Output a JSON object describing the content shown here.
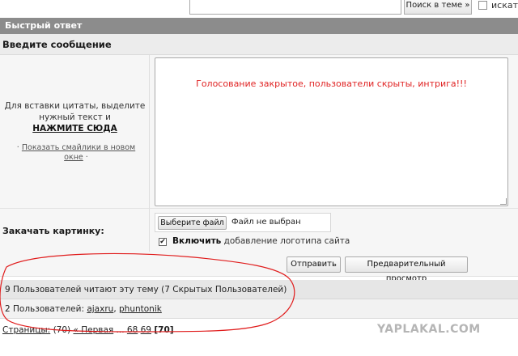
{
  "top": {
    "search_topic_button": "Поиск в теме »",
    "search_checkbox_label": "искат"
  },
  "reply": {
    "header": "Быстрый ответ",
    "subheader": "Введите сообщение",
    "quote_hint": "Для вставки цитаты, выделите нужный текст и",
    "quote_link": "НАЖМИТЕ СЮДА",
    "smileys_prefix": "·",
    "smileys_link": "Показать смайлики в новом окне",
    "smileys_suffix": "·",
    "message_text": "Голосование закрытое, пользователи скрыты, интрига!!!"
  },
  "upload": {
    "label": "Закачать картинку:",
    "choose_button": "Выберите файл",
    "file_status": "Файл не выбран",
    "logo_checked": true,
    "logo_bold": "Включить",
    "logo_rest": " добавление логотипа сайта"
  },
  "actions": {
    "send": "Отправить",
    "preview": "Предварительный просмотр"
  },
  "readers": {
    "summary": "9 Пользователей читают эту тему (7 Скрытых Пользователей)",
    "users_prefix": "2 Пользователей: ",
    "users": [
      "ajaxru",
      "phuntonik"
    ]
  },
  "pagination": {
    "label": "Страницы:",
    "total": "(70)",
    "first": "« Первая",
    "dots": "...",
    "pages": [
      "68",
      "69"
    ],
    "current": "[70]"
  },
  "watermark": "YAPLAKAL.COM",
  "colors": {
    "header_bg": "#8c8c8c",
    "message_text": "#e02424",
    "annotation": "#e01b1b"
  }
}
